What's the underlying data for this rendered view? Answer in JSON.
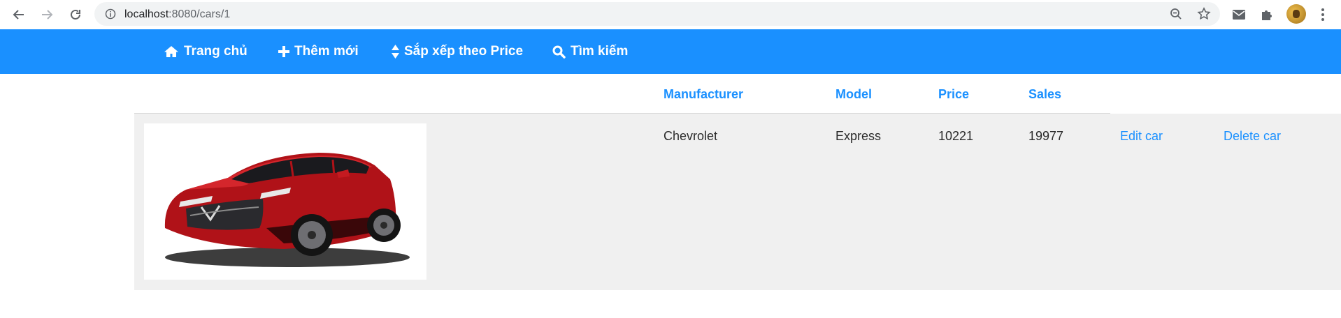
{
  "browser": {
    "url_host": "localhost",
    "url_path": ":8080/cars/1",
    "icons": [
      "back-arrow-icon",
      "forward-arrow-icon",
      "reload-icon",
      "site-info-icon",
      "zoom-out-icon",
      "bookmark-star-icon",
      "mail-icon",
      "extensions-puzzle-icon",
      "profile-avatar",
      "menu-kebab-icon"
    ]
  },
  "navbar": {
    "color": "#1a90ff",
    "items": [
      {
        "label": "Trang chủ",
        "icon": "home-icon"
      },
      {
        "label": "Thêm mới",
        "icon": "plus-icon"
      },
      {
        "label": "Sắp xếp theo Price",
        "icon": "sort-icon"
      },
      {
        "label": "Tìm kiếm",
        "icon": "search-icon"
      }
    ]
  },
  "table": {
    "headers": [
      "Manufacturer",
      "Model",
      "Price",
      "Sales"
    ],
    "rows": [
      {
        "image": "red-suv-car-image",
        "manufacturer": "Chevrolet",
        "model": "Express",
        "price": "10221",
        "sales": "19977",
        "edit_label": "Edit car",
        "delete_label": "Delete car"
      }
    ]
  }
}
